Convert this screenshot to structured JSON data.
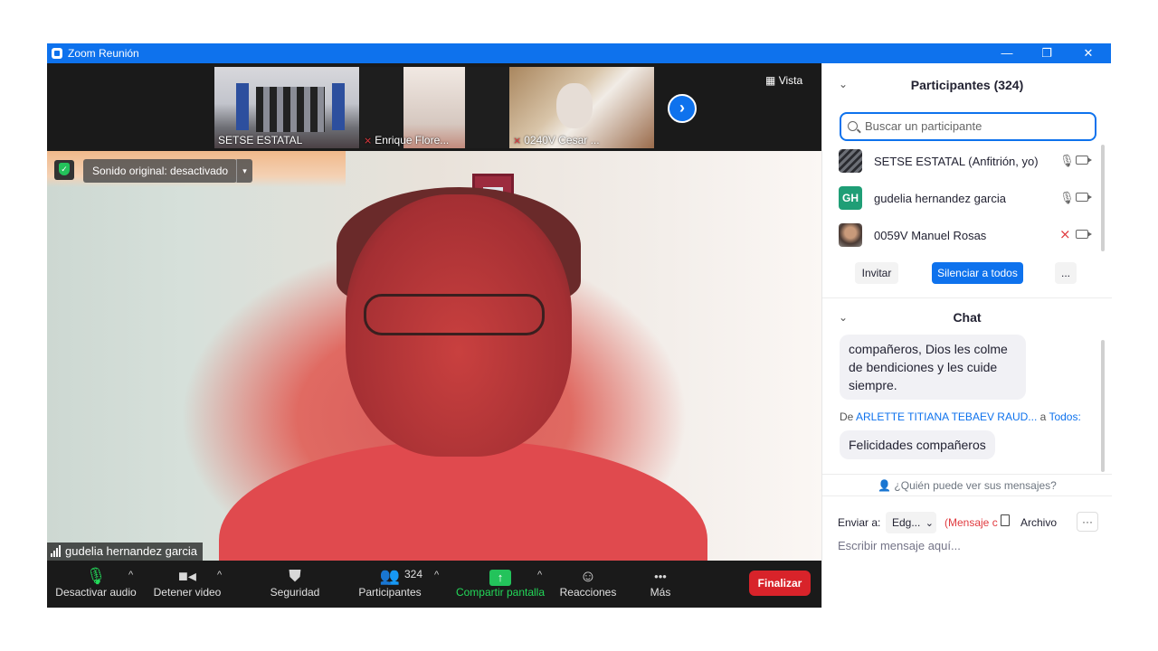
{
  "window": {
    "title": "Zoom Reunión",
    "controls": {
      "minimize": "—",
      "restore": "❐",
      "close": "✕"
    }
  },
  "thumbnails": [
    {
      "label": "SETSE ESTATAL",
      "muted": false
    },
    {
      "label": "Enrique Flore...",
      "muted": true
    },
    {
      "label": "0240V Cesar ...",
      "muted": true
    }
  ],
  "next_icon": "›",
  "view_button": {
    "icon": "grid-icon",
    "label": "Vista"
  },
  "main_video": {
    "sound_label": "Sonido original: desactivado",
    "sound_arrow": "▾",
    "speaker_name": "gudelia hernandez garcia"
  },
  "toolbar": {
    "audio_label": "Desactivar audio",
    "video_label": "Detener video",
    "security_label": "Seguridad",
    "participants_label": "Participantes",
    "participants_count": "324",
    "share_label": "Compartir pantalla",
    "share_icon": "↑",
    "reactions_label": "Reacciones",
    "more_label": "Más",
    "more_icon": "•••",
    "end_label": "Finalizar",
    "caret": "^"
  },
  "participants_panel": {
    "collapse_icon": "⌄",
    "title": "Participantes (324)",
    "search_placeholder": "Buscar un participante",
    "items": [
      {
        "name": "SETSE ESTATAL (Anfitrión, yo)",
        "avatar_initials": "",
        "mic_muted": false
      },
      {
        "name": "gudelia hernandez garcia",
        "avatar_initials": "GH",
        "mic_muted": false
      },
      {
        "name": "0059V Manuel Rosas",
        "avatar_initials": "",
        "mic_muted": true
      }
    ],
    "mic_icon": "🎙",
    "mic_muted_icon": "⨯",
    "invite_label": "Invitar",
    "mute_all_label": "Silenciar a todos",
    "more_label": "..."
  },
  "chat_panel": {
    "collapse_icon": "⌄",
    "title": "Chat",
    "message_1_lines": [
      "compañeros, Dios les colme",
      "de bendiciones y les cuide",
      "siempre."
    ],
    "from_prefix": "De",
    "from_name": "ARLETTE TITIANA TEBAEV RAUD...",
    "to_prefix": "a",
    "to_name": "Todos:",
    "message_2": "Felicidades compañeros",
    "who_sees": "¿Quién puede ver sus mensajes?",
    "send_to_label": "Enviar a:",
    "send_to_value": "Edg...",
    "send_to_caret": "⌄",
    "private_note": "(Mensaje c",
    "file_label": "Archivo",
    "more_icon": "···",
    "input_placeholder": "Escribir mensaje aquí..."
  },
  "colors": {
    "accent": "#0e72ed",
    "end": "#d8232a",
    "share": "#23c35b",
    "muted": "#e0393e",
    "dark": "#1a1a1a"
  }
}
